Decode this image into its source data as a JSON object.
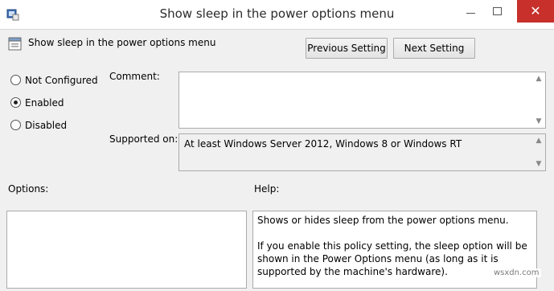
{
  "window": {
    "title": "Show sleep in the power options menu",
    "minimize_glyph": "",
    "maximize_glyph": "",
    "close_glyph": "✕"
  },
  "header": {
    "policy_name": "Show sleep in the power options menu",
    "previous_label": "Previous Setting",
    "next_label": "Next Setting"
  },
  "state": {
    "options": [
      {
        "label": "Not Configured",
        "selected": false
      },
      {
        "label": "Enabled",
        "selected": true
      },
      {
        "label": "Disabled",
        "selected": false
      }
    ]
  },
  "comment": {
    "label": "Comment:",
    "value": ""
  },
  "supported": {
    "label": "Supported on:",
    "value": "At least Windows Server 2012, Windows 8 or Windows RT"
  },
  "options_pane": {
    "label": "Options:"
  },
  "help_pane": {
    "label": "Help:",
    "paragraphs": [
      "Shows or hides sleep from the power options menu.",
      "If you enable this policy setting, the sleep option will be shown in the Power Options menu (as long as it is supported by the machine's hardware)."
    ]
  },
  "watermark": "wsxdn.com",
  "icons": {
    "title_icon": "group-policy-icon",
    "policy_icon": "policy-setting-icon"
  },
  "colors": {
    "close_button": "#c7302b",
    "window_bg": "#f0f0f0"
  }
}
